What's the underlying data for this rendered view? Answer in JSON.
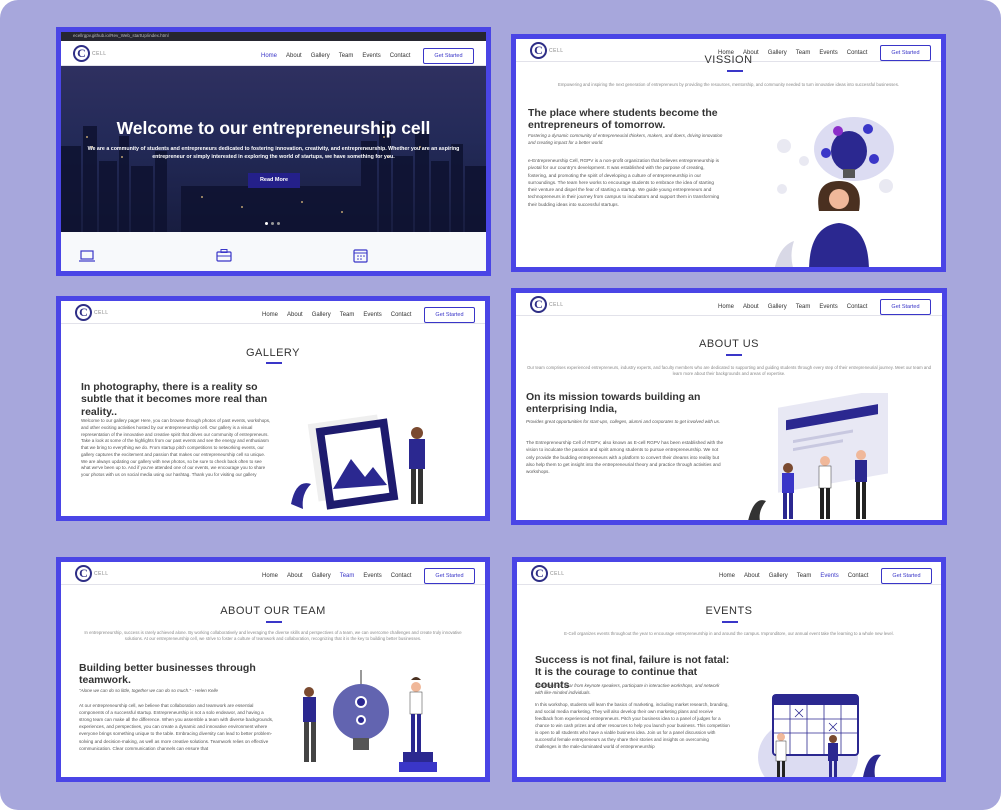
{
  "colors": {
    "accent": "#4a45e6",
    "nav_active": "#3a36c8",
    "page_bg": "#a7a7dc"
  },
  "logo": {
    "letter": "C",
    "text": "CELL"
  },
  "menu": [
    "Home",
    "About",
    "Gallery",
    "Team",
    "Events",
    "Contact"
  ],
  "get_started": "Get Started",
  "p1": {
    "url_bar": "ecellrgpv.github.io/Rev_Web_startUp/index.html",
    "hero_title": "Welcome to our entrepreneurship cell",
    "hero_text": "We are a community of students and entrepreneurs dedicated to fostering innovation, creativity, and entrepreneurship. Whether you are an aspiring entrepreneur or simply interested in exploring the world of startups, we have something for you.",
    "read_more": "Read More",
    "icons": [
      "laptop-icon",
      "briefcase-icon",
      "calendar-icon"
    ]
  },
  "p2": {
    "title": "VISSION",
    "subtitle": "Empowering and inspiring the next generation of entrepreneurs by providing the resources, mentorship, and community needed to turn innovative ideas into successful businesses.",
    "heading": "The place where students become the entrepreneurs of tomorrow.",
    "italic": "Fostering a dynamic community of entrepreneurial thinkers, makers, and doers, driving innovation and creating impact for a better world.",
    "body": "e-Entrepreneurship Cell, RGPV is a non-profit organization that believes entrepreneurship is pivotal for our country's development. It was established with the purpose of creating, fostering, and promoting the spirit of developing a culture of entrepreneurship in our surroundings. The team here works to encourage students to embrace the idea of starting their venture and dispel the fear of starting a startup. We guide young entrepreneurs and technopreneurs in their journey from campus to incubators and support them in transforming their budding ideas into successful startups."
  },
  "p3": {
    "title": "GALLERY",
    "heading": "In photography, there is a reality so subtle that it becomes more real than reality..",
    "body": "Welcome to our gallery page! Here, you can browse through photos of past events, workshops, and other exciting activities hosted by our entrepreneurship cell. Our gallery is a visual representation of the innovative and creative spirit that drives our community of entrepreneurs. Take a look at some of the highlights from our past events and see the energy and enthusiasm that we bring to everything we do. From startup pitch competitions to networking events, our gallery captures the excitement and passion that makes our entrepreneurship cell so unique. We are always updating our gallery with new photos, so be sure to check back often to see what we've been up to. And if you've attended one of our events, we encourage you to share your photos with us on social media using our hashtag. Thank you for visiting our gallery"
  },
  "p4": {
    "title": "ABOUT US",
    "subtitle": "Our team comprises experienced entrepreneurs, industry experts, and faculty members who are dedicated to supporting and guiding students through every step of their entrepreneurial journey. Meet our team and learn more about their backgrounds and areas of expertise.",
    "heading": "On its mission towards building an enterprising India,",
    "italic": "Provides great opportunities for start-ups, colleges, alumni and corporates to get involved with us.",
    "body": "The Entrepreneurship Cell of RGPV, also known as E-cell RGPV has been established with the vision to inculcate the passion and spirit among students to pursue entrepreneurship. We not only provide the budding entrepreneurs with a platform to convert their dreams into reality but also help them to get insight into the entrepreneurial theory and practice through activities and workshops."
  },
  "p5": {
    "title": "ABOUT OUR TEAM",
    "subtitle": "In entrepreneurship, success is rarely achieved alone. By working collaboratively and leveraging the diverse skills and perspectives of a team, we can overcome challenges and create truly innovative solutions. At our entrepreneurship cell, we strive to foster a culture of teamwork and collaboration, recognizing that it is the key to building better businesses.",
    "heading": "Building better businesses through teamwork.",
    "italic": "\"Alone we can do so little, together we can do so much.\" - Helen Kelle",
    "body": "At our entrepreneurship cell, we believe that collaboration and teamwork are essential components of a successful startup. Entrepreneurship is not a solo endeavor, and having a strong team can make all the difference. When you assemble a team with diverse backgrounds, experiences, and perspectives, you can create a dynamic and innovative environment where everyone brings something unique to the table. Embracing diversity can lead to better problem-solving and decision-making, as well as more creative solutions. Teamwork relies on effective communication. Clear communication channels can ensure that"
  },
  "p6": {
    "title": "EVENTS",
    "subtitle": "E-Cell organizes events throughout the year to encourage entrepreneurship in and around the campus. Impronditore, our annual event take the learning to a whole new level.",
    "heading": "Success is not final, failure is not fatal: It is the courage to continue that counts",
    "italic": "Attendees will hear from keynote speakers, participate in interactive workshops, and network with like-minded individuals.",
    "body": "In this workshop, students will learn the basics of marketing, including market research, branding, and social media marketing. They will also develop their own marketing plans and receive feedback from experienced entrepreneurs. Pitch your business idea to a panel of judges for a chance to win cash prizes and other resources to help you launch your business. This competition is open to all students who have a viable business idea. Join us for a panel discussion with successful female entrepreneurs as they share their stories and insights on overcoming challenges in the male-dominated world of entrepreneurship"
  }
}
